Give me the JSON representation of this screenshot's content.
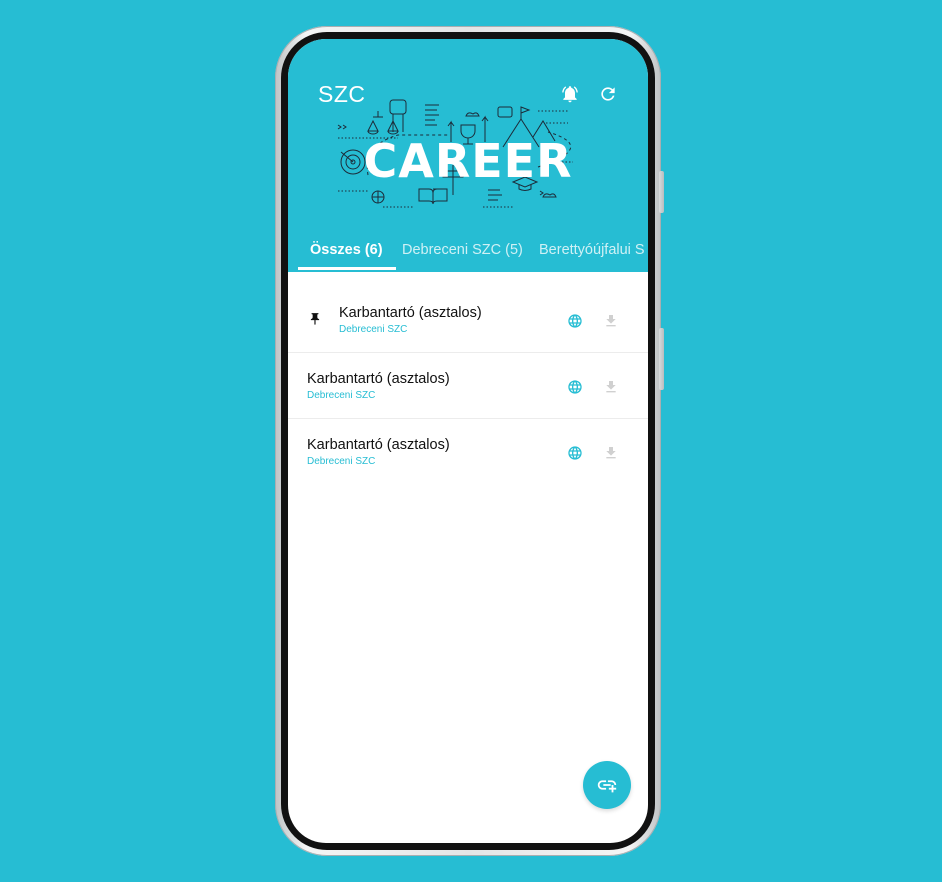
{
  "header": {
    "title": "SZC",
    "banner_text": "CAREER",
    "bell_icon": "bell-icon",
    "refresh_icon": "refresh-icon"
  },
  "tabs": [
    {
      "label": "Összes (6)",
      "active": true
    },
    {
      "label": "Debreceni SZC (5)",
      "active": false
    },
    {
      "label": "Berettyóújfalui S",
      "active": false
    }
  ],
  "items": [
    {
      "title": "Karbantartó (asztalos)",
      "subtitle": "Debreceni SZC",
      "pinned": true
    },
    {
      "title": "Karbantartó (asztalos)",
      "subtitle": "Debreceni SZC",
      "pinned": false
    },
    {
      "title": "Karbantartó (asztalos)",
      "subtitle": "Debreceni SZC",
      "pinned": false
    }
  ],
  "fab_icon": "add-link-icon",
  "colors": {
    "accent": "#26bdd3",
    "background": "#26bdd3",
    "disabled": "#d0d0d0"
  }
}
